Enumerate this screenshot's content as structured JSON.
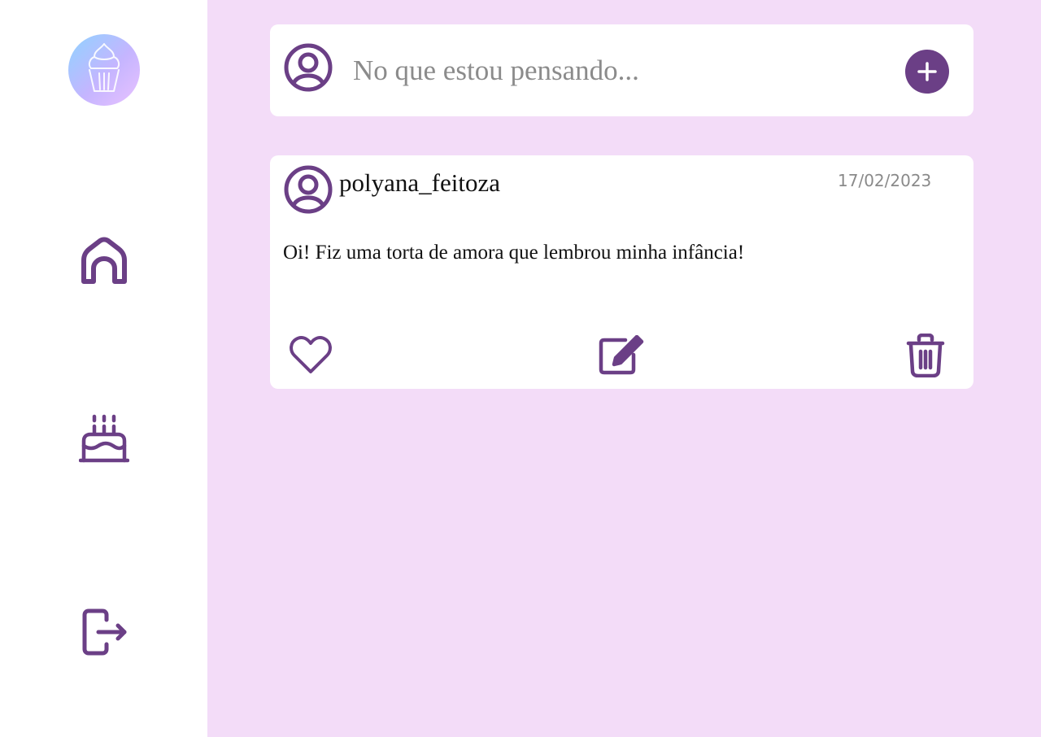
{
  "sidebar": {
    "logo_icon": "cupcake-icon",
    "items": [
      {
        "name": "home",
        "icon": "home-icon"
      },
      {
        "name": "cakes",
        "icon": "cake-icon"
      },
      {
        "name": "logout",
        "icon": "logout-icon"
      }
    ]
  },
  "composer": {
    "avatar_icon": "user-circle-icon",
    "placeholder": "No que estou pensando...",
    "value": "",
    "add_icon": "plus-icon"
  },
  "posts": [
    {
      "author": "polyana_feitoza",
      "date": "17/02/2023",
      "text": "Oi! Fiz uma torta de amora que lembrou minha infância!",
      "actions": [
        "heart-icon",
        "edit-icon",
        "trash-icon"
      ]
    }
  ],
  "colors": {
    "accent": "#6b3f86",
    "background": "#f3dcf8",
    "card": "#ffffff",
    "muted_text": "#8a8a8a"
  }
}
